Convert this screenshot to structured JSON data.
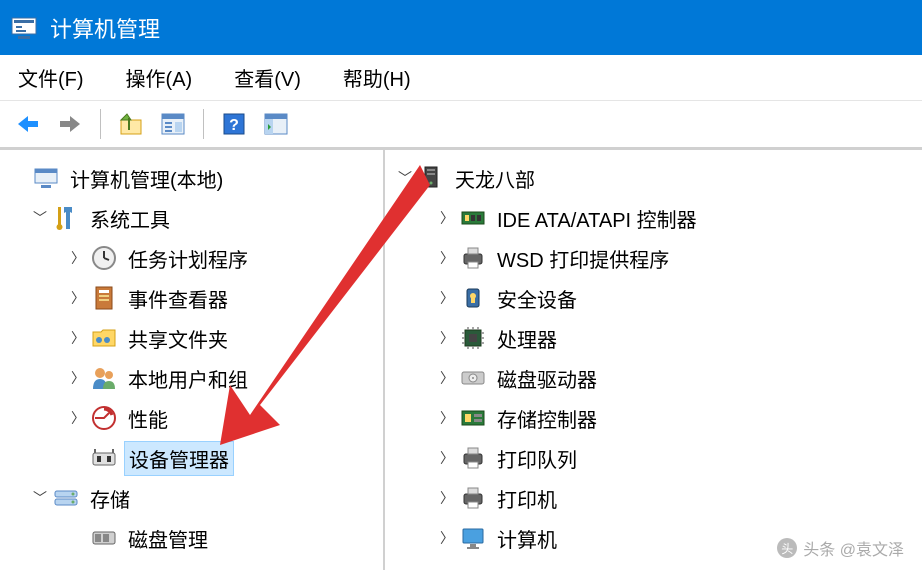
{
  "window": {
    "title": "计算机管理"
  },
  "menu": {
    "file": "文件(F)",
    "action": "操作(A)",
    "view": "查看(V)",
    "help": "帮助(H)"
  },
  "left_tree": {
    "root": "计算机管理(本地)",
    "system_tools": "系统工具",
    "task_scheduler": "任务计划程序",
    "event_viewer": "事件查看器",
    "shared_folders": "共享文件夹",
    "local_users": "本地用户和组",
    "performance": "性能",
    "device_manager": "设备管理器",
    "storage": "存储",
    "disk_management": "磁盘管理"
  },
  "right_tree": {
    "root": "天龙八部",
    "ide": "IDE ATA/ATAPI 控制器",
    "wsd": "WSD 打印提供程序",
    "security": "安全设备",
    "processor": "处理器",
    "disk_drives": "磁盘驱动器",
    "storage_ctrl": "存储控制器",
    "print_queue": "打印队列",
    "printer": "打印机",
    "computer": "计算机"
  },
  "watermark": {
    "text": "头条 @袁文泽"
  }
}
